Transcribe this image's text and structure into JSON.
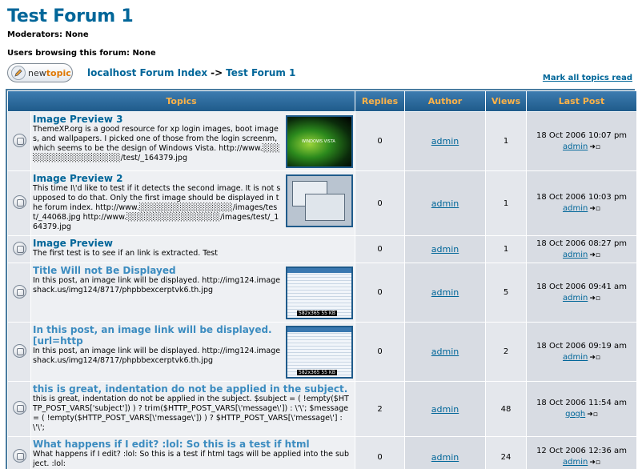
{
  "forum": {
    "title": "Test Forum 1",
    "moderators": "Moderators: None",
    "browsing": "Users browsing this forum: None"
  },
  "nav": {
    "new_topic_prefix": "new",
    "new_topic_suffix": "topic",
    "index_label": "localhost Forum Index",
    "separator": "->",
    "current_label": "Test Forum 1",
    "mark_all_read": "Mark all topics read"
  },
  "table": {
    "headers": {
      "topics": "Topics",
      "replies": "Replies",
      "author": "Author",
      "views": "Views",
      "last_post": "Last Post"
    },
    "rows": [
      {
        "title": "Image Preview 3",
        "preview": "ThemeXP.org is a good resource for xp login images, boot images, and wallpapers. I picked one of those from the login screenm, which seems to be the design of Windows Vista. http://www.░░░░░░░░░░░░░░░░░░/test/_164379.jpg",
        "replies": "0",
        "author": "admin",
        "views": "1",
        "last_date": "18 Oct 2006 10:07 pm",
        "last_user": "admin"
      },
      {
        "title": "Image Preview 2",
        "preview": "This time I\\'d like to test if it detects the second image. It is not supposed to do that. Only the first image should be displayed in the forum index. http://www.░░░░░░░░░░░░░░░░/images/test/_44068.jpg http://www.░░░░░░░░░░░░░░░░/images/test/_164379.jpg",
        "replies": "0",
        "author": "admin",
        "views": "1",
        "last_date": "18 Oct 2006 10:03 pm",
        "last_user": "admin"
      },
      {
        "title": "Image Preview",
        "preview": "The first test is to see if an link is extracted. Test",
        "replies": "0",
        "author": "admin",
        "views": "1",
        "last_date": "18 Oct 2006 08:27 pm",
        "last_user": "admin"
      },
      {
        "title": "Title Will not Be Displayed",
        "preview": "In this post, an image link will be displayed. http://img124.imageshack.us/img124/8717/phpbbexcerptvk6.th.jpg",
        "replies": "0",
        "author": "admin",
        "views": "5",
        "last_date": "18 Oct 2006 09:41 am",
        "last_user": "admin"
      },
      {
        "title": "In this post, an image link will be displayed. [url=http",
        "preview": "In this post, an image link will be displayed. http://img124.imageshack.us/img124/8717/phpbbexcerptvk6.th.jpg",
        "replies": "0",
        "author": "admin",
        "views": "2",
        "last_date": "18 Oct 2006 09:19 am",
        "last_user": "admin"
      },
      {
        "title": "this is great, indentation do not be applied in the subject.",
        "preview": "this is great, indentation do not be applied in the subject. $subject = ( !empty($HTTP_POST_VARS['subject']) ) ? trim($HTTP_POST_VARS[\\'message\\']) : \\'\\'; $message = ( !empty($HTTP_POST_VARS[\\'message\\']) ) ? $HTTP_POST_VARS[\\'message\\'] : \\'\\';",
        "replies": "2",
        "author": "admin",
        "views": "48",
        "last_date": "18 Oct 2006 11:54 am",
        "last_user": "gogh"
      },
      {
        "title": "What happens if I edit? :lol: So this is a test if html",
        "preview": "What happens if I edit? :lol: So this is a test if html tags will be applied into the subject. :lol:",
        "replies": "0",
        "author": "admin",
        "views": "24",
        "last_date": "12 Oct 2006 12:36 am",
        "last_user": "admin"
      }
    ]
  },
  "icons": {
    "topic": "folder-icon",
    "newest": "goto-post-icon",
    "new_topic": "pencil-icon"
  },
  "colors": {
    "link": "#006699",
    "header_bg": "#1f5b8b",
    "header_text": "#ffb347"
  }
}
